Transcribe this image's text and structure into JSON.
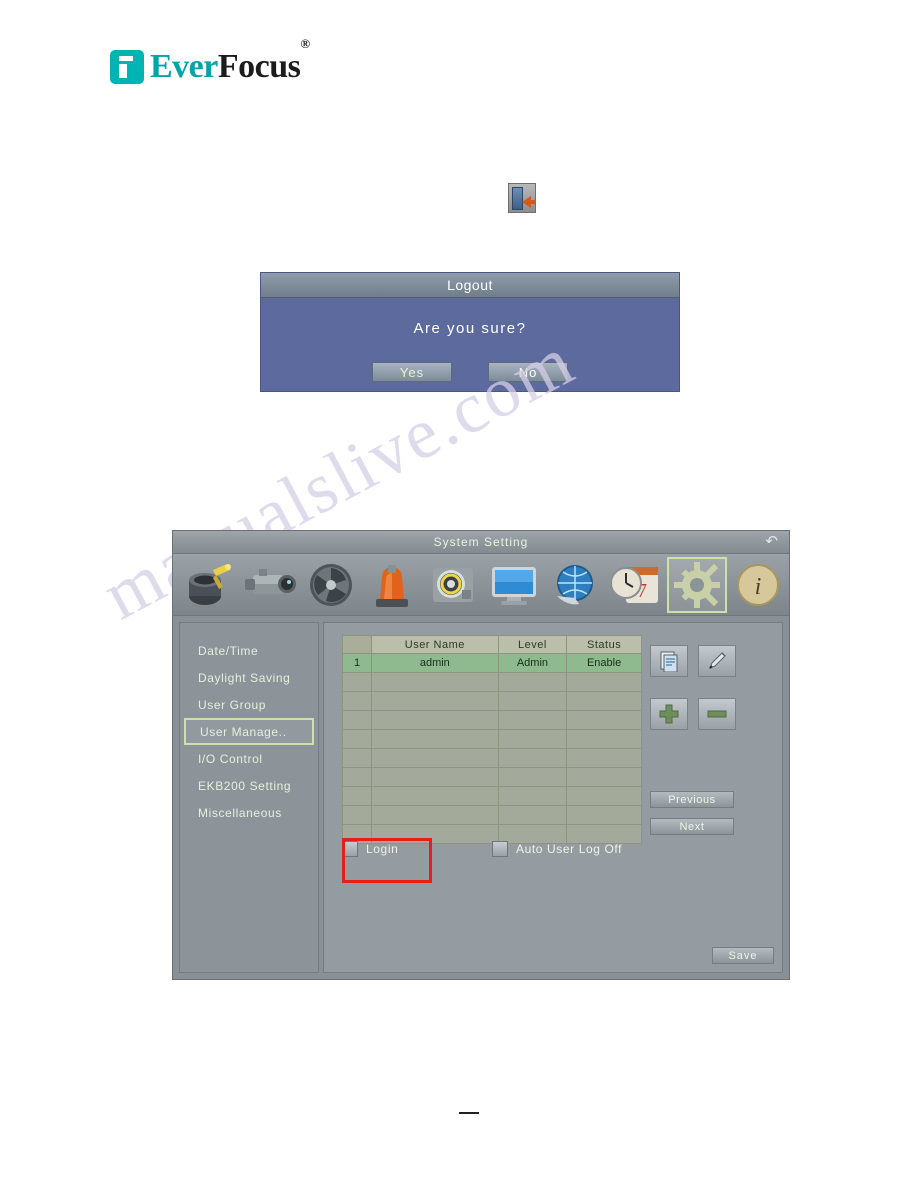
{
  "brand": {
    "name_part1": "Ever",
    "name_part2": "Focus",
    "registered": "®"
  },
  "watermark": {
    "line1": "manualslive.com"
  },
  "logout_icon": {
    "name": "logout-icon"
  },
  "logout_dialog": {
    "title": "Logout",
    "question": "Are you sure?",
    "yes_label": "Yes",
    "no_label": "No"
  },
  "system_setting": {
    "title": "System Setting",
    "back_arrow": "↶",
    "toolbar_icons": [
      {
        "name": "camera-setup-icon",
        "label": "Camera"
      },
      {
        "name": "lens-icon",
        "label": "Lens"
      },
      {
        "name": "fan-icon",
        "label": "Fan"
      },
      {
        "name": "alarm-light-icon",
        "label": "Alarm"
      },
      {
        "name": "disk-icon",
        "label": "Disk"
      },
      {
        "name": "monitor-icon",
        "label": "Display"
      },
      {
        "name": "network-icon",
        "label": "Network"
      },
      {
        "name": "schedule-clock-icon",
        "label": "Schedule"
      },
      {
        "name": "system-gear-icon",
        "label": "System"
      },
      {
        "name": "information-icon",
        "label": "Information"
      }
    ],
    "menu": [
      {
        "label": "Date/Time",
        "active": false
      },
      {
        "label": "Daylight Saving",
        "active": false
      },
      {
        "label": "User Group",
        "active": false
      },
      {
        "label": "User Manage..",
        "active": true
      },
      {
        "label": "I/O Control",
        "active": false
      },
      {
        "label": "EKB200 Setting",
        "active": false
      },
      {
        "label": "Miscellaneous",
        "active": false
      }
    ],
    "user_table": {
      "headers": [
        "",
        "User Name",
        "Level",
        "Status"
      ],
      "rows": [
        {
          "idx": "1",
          "user_name": "admin",
          "level": "Admin",
          "status": "Enable",
          "selected": true
        },
        {
          "idx": "",
          "user_name": "",
          "level": "",
          "status": "",
          "selected": false
        },
        {
          "idx": "",
          "user_name": "",
          "level": "",
          "status": "",
          "selected": false
        },
        {
          "idx": "",
          "user_name": "",
          "level": "",
          "status": "",
          "selected": false
        },
        {
          "idx": "",
          "user_name": "",
          "level": "",
          "status": "",
          "selected": false
        },
        {
          "idx": "",
          "user_name": "",
          "level": "",
          "status": "",
          "selected": false
        },
        {
          "idx": "",
          "user_name": "",
          "level": "",
          "status": "",
          "selected": false
        },
        {
          "idx": "",
          "user_name": "",
          "level": "",
          "status": "",
          "selected": false
        },
        {
          "idx": "",
          "user_name": "",
          "level": "",
          "status": "",
          "selected": false
        },
        {
          "idx": "",
          "user_name": "",
          "level": "",
          "status": "",
          "selected": false
        }
      ]
    },
    "side_buttons": [
      {
        "name": "copy-user-button",
        "icon": "clipboard-icon"
      },
      {
        "name": "edit-user-button",
        "icon": "pencil-icon"
      },
      {
        "name": "add-user-button",
        "icon": "plus-icon"
      },
      {
        "name": "remove-user-button",
        "icon": "minus-icon"
      }
    ],
    "previous_label": "Previous",
    "next_label": "Next",
    "checkboxes": [
      {
        "name": "login-checkbox",
        "label": "Login",
        "checked": false
      },
      {
        "name": "auto-user-logoff-checkbox",
        "label": "Auto User Log Off",
        "checked": false
      }
    ],
    "save_label": "Save"
  },
  "colors": {
    "brand_teal": "#00a5a8",
    "highlight_red": "#e32119",
    "dialog_blue": "#5c6a9e",
    "selection_green": "#8fba8f",
    "accent_border": "#cfe0a8"
  }
}
